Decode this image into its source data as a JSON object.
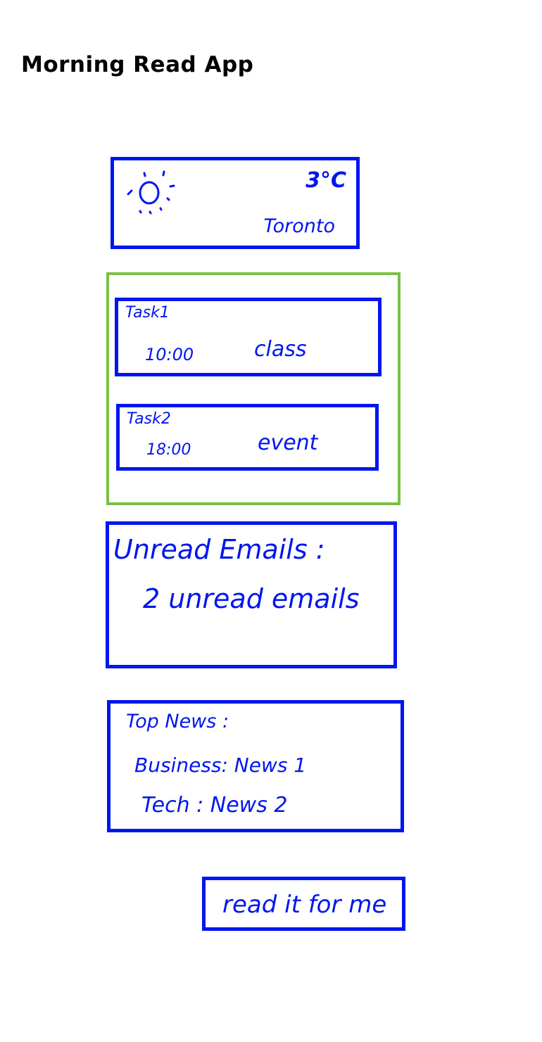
{
  "app": {
    "title": "Morning Read App"
  },
  "weather": {
    "icon": "sun-icon",
    "temperature": "3°C",
    "city": "Toronto"
  },
  "tasks": [
    {
      "title": "Task1",
      "time": "10:00",
      "name": "class"
    },
    {
      "title": "Task2",
      "time": "18:00",
      "name": "event"
    }
  ],
  "emails": {
    "title": "Unread Emails :",
    "count_text": "2 unread emails"
  },
  "news": {
    "title": "Top News :",
    "business": "Business: News 1",
    "tech": "Tech  :  News 2"
  },
  "actions": {
    "read_label": "read it for me"
  },
  "colors": {
    "card_border": "#0016ee",
    "group_border": "#7ac143",
    "title_text": "#000000"
  }
}
